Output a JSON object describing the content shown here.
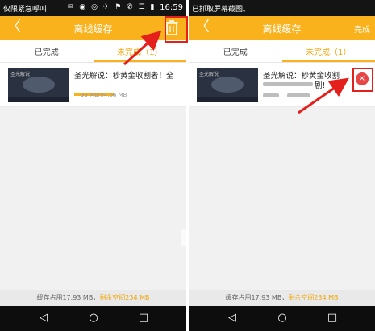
{
  "left": {
    "status": {
      "text": "仅限紧急呼叫",
      "time": "16:59"
    },
    "header": {
      "back": "〈",
      "title": "离线缓存"
    },
    "tabs": [
      {
        "label": "已完成"
      },
      {
        "label": "未完成（1）"
      }
    ],
    "item": {
      "thumb_caption": "圣光解说",
      "title": "圣光解说：秒黄金收割者！全",
      "size": "93 MB/94.66 MB",
      "progress": 0.98
    },
    "footer": {
      "used": "缓存占用17.93 MB，",
      "free": "剩余空间234 MB"
    }
  },
  "right": {
    "status": {
      "text": "已抓取屏幕截图。"
    },
    "header": {
      "back": "〈",
      "title": "离线缓存",
      "done": "完成"
    },
    "tabs": [
      {
        "label": "已完成"
      },
      {
        "label": "未完成（1）"
      }
    ],
    "item": {
      "thumb_caption": "圣光解说",
      "title_line1": "圣光解说：秒黄金收割",
      "title_line2": "剧!",
      "delete_icon": "×"
    },
    "footer": {
      "used": "缓存占用17.93 MB，",
      "free": "剩余空间234 MB"
    }
  },
  "nav": {
    "back": "◁",
    "home": "○",
    "recent": "□"
  },
  "colors": {
    "accent": "#f9b21c",
    "highlight": "#e3201b",
    "delete": "#e84545"
  }
}
